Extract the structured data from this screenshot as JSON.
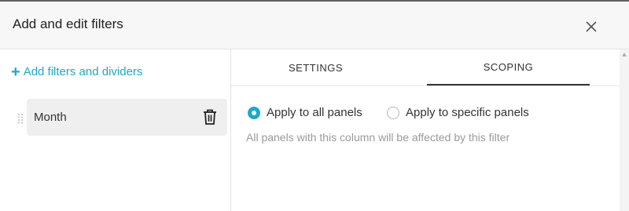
{
  "modal": {
    "title": "Add and edit filters",
    "close_icon": "close-icon"
  },
  "left_panel": {
    "add_link_label": "Add filters and dividers",
    "add_link_icon": "plus-icon",
    "filters": [
      {
        "label": "Month",
        "delete_icon": "trash-icon"
      }
    ]
  },
  "tabs": [
    {
      "label": "SETTINGS",
      "active": false
    },
    {
      "label": "SCOPING",
      "active": true
    }
  ],
  "scoping": {
    "options": [
      {
        "label": "Apply to all panels",
        "selected": true
      },
      {
        "label": "Apply to specific panels",
        "selected": false
      }
    ],
    "hint": "All panels with this column will be affected by this filter"
  },
  "colors": {
    "accent": "#20a7c9",
    "header_bg": "#f7f7f7",
    "item_bg": "#efefef",
    "hint_text": "#9a9a9a"
  }
}
